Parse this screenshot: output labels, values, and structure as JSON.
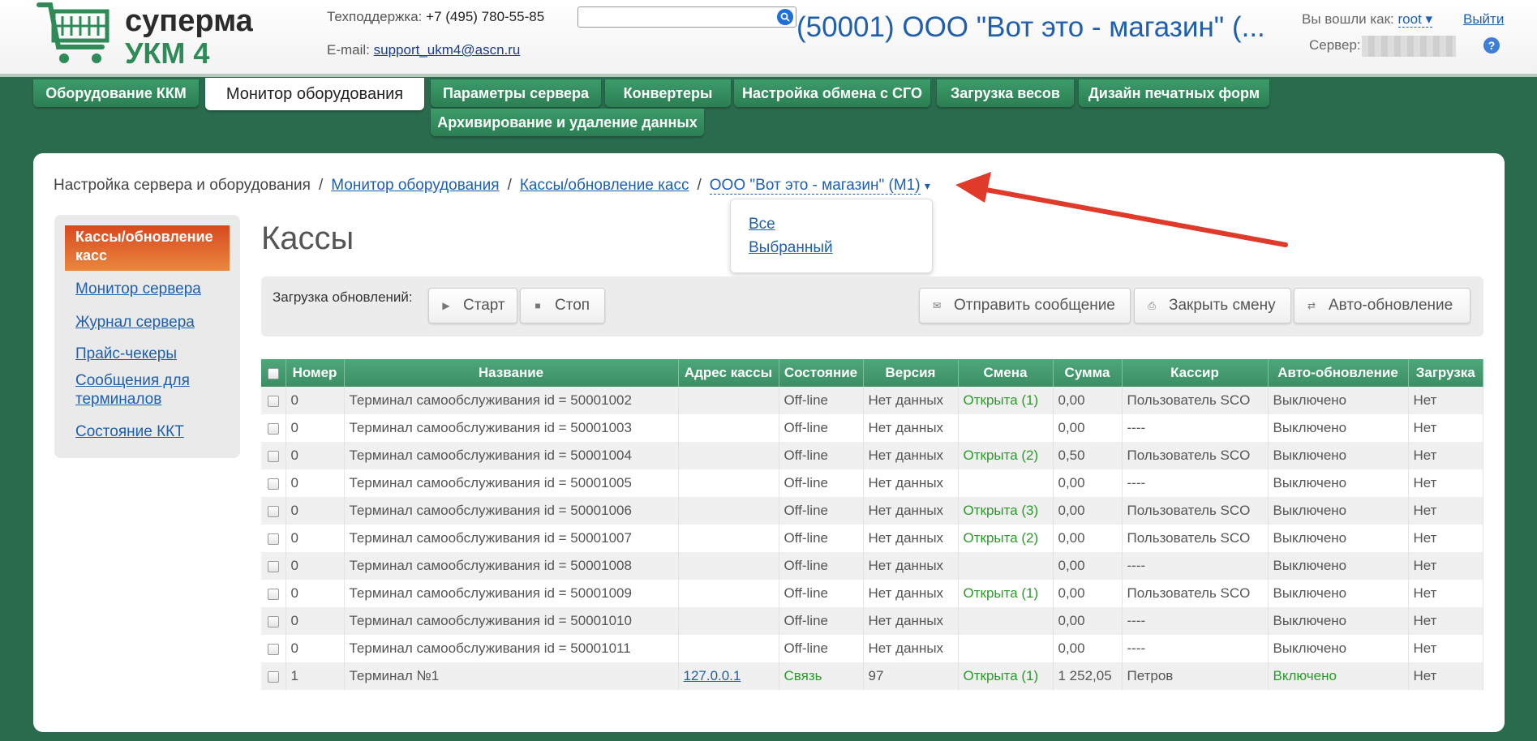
{
  "header": {
    "logo_line1": "супермаг",
    "logo_line2": "УКМ 4",
    "support_label": "Техподдержка:",
    "support_phone": "+7 (495) 780-55-85",
    "email_label": "E-mail:",
    "email": "support_ukm4@ascn.ru",
    "search_placeholder": "",
    "store_title": "(50001) ООО \"Вот это - магазин\" (...",
    "logged_in_label": "Вы вошли как:",
    "user": "root ▾",
    "logout": "Выйти",
    "server_label": "Сервер:",
    "help": "?"
  },
  "nav": {
    "tabs": [
      "Оборудование ККМ",
      "Монитор оборудования",
      "Параметры сервера",
      "Конвертеры",
      "Настройка обмена с СГО",
      "Загрузка весов",
      "Дизайн печатных форм",
      "Архивирование и удаление данных"
    ]
  },
  "breadcrumb": {
    "root": "Настройка сервера и оборудования",
    "sep": "/",
    "item1": "Монитор оборудования",
    "item2": "Кассы/обновление касс",
    "current": "ООО \"Вот это - магазин\" (М1)",
    "caret": "▾"
  },
  "dropdown": {
    "options": [
      "Все",
      "Выбранный"
    ]
  },
  "sidebar": {
    "active": "Кассы/обновление касс",
    "links": [
      "Монитор сервера",
      "Журнал сервера",
      "Прайс-чекеры",
      "Сообщения для терминалов",
      "Состояние ККТ"
    ]
  },
  "page_title": "Кассы",
  "toolbar": {
    "label": "Загрузка обновлений:",
    "start": "Старт",
    "stop": "Стоп",
    "send_message": "Отправить сообщение",
    "close_shift": "Закрыть смену",
    "auto_update": "Авто-обновление"
  },
  "table": {
    "columns": [
      "Номер",
      "Название",
      "Адрес кассы",
      "Состояние",
      "Версия",
      "Смена",
      "Сумма",
      "Кассир",
      "Авто-обновление",
      "Загрузка"
    ],
    "rows": [
      {
        "num": "0",
        "name": "Терминал самообслуживания id = 50001002",
        "addr": "",
        "state": "Off-line",
        "version": "Нет данных",
        "shift": "Открыта (1)",
        "sum": "0,00",
        "cashier": "Пользователь SCO",
        "auto": "Выключено",
        "load": "Нет"
      },
      {
        "num": "0",
        "name": "Терминал самообслуживания id = 50001003",
        "addr": "",
        "state": "Off-line",
        "version": "Нет данных",
        "shift": "",
        "sum": "0,00",
        "cashier": "----",
        "auto": "Выключено",
        "load": "Нет"
      },
      {
        "num": "0",
        "name": "Терминал самообслуживания id = 50001004",
        "addr": "",
        "state": "Off-line",
        "version": "Нет данных",
        "shift": "Открыта (2)",
        "sum": "0,50",
        "cashier": "Пользователь SCO",
        "auto": "Выключено",
        "load": "Нет"
      },
      {
        "num": "0",
        "name": "Терминал самообслуживания id = 50001005",
        "addr": "",
        "state": "Off-line",
        "version": "Нет данных",
        "shift": "",
        "sum": "0,00",
        "cashier": "----",
        "auto": "Выключено",
        "load": "Нет"
      },
      {
        "num": "0",
        "name": "Терминал самообслуживания id = 50001006",
        "addr": "",
        "state": "Off-line",
        "version": "Нет данных",
        "shift": "Открыта (3)",
        "sum": "0,00",
        "cashier": "Пользователь SCO",
        "auto": "Выключено",
        "load": "Нет"
      },
      {
        "num": "0",
        "name": "Терминал самообслуживания id = 50001007",
        "addr": "",
        "state": "Off-line",
        "version": "Нет данных",
        "shift": "Открыта (2)",
        "sum": "0,00",
        "cashier": "Пользователь SCO",
        "auto": "Выключено",
        "load": "Нет"
      },
      {
        "num": "0",
        "name": "Терминал самообслуживания id = 50001008",
        "addr": "",
        "state": "Off-line",
        "version": "Нет данных",
        "shift": "",
        "sum": "0,00",
        "cashier": "----",
        "auto": "Выключено",
        "load": "Нет"
      },
      {
        "num": "0",
        "name": "Терминал самообслуживания id = 50001009",
        "addr": "",
        "state": "Off-line",
        "version": "Нет данных",
        "shift": "Открыта (1)",
        "sum": "0,00",
        "cashier": "Пользователь SCO",
        "auto": "Выключено",
        "load": "Нет"
      },
      {
        "num": "0",
        "name": "Терминал самообслуживания id = 50001010",
        "addr": "",
        "state": "Off-line",
        "version": "Нет данных",
        "shift": "",
        "sum": "0,00",
        "cashier": "----",
        "auto": "Выключено",
        "load": "Нет"
      },
      {
        "num": "0",
        "name": "Терминал самообслуживания id = 50001011",
        "addr": "",
        "state": "Off-line",
        "version": "Нет данных",
        "shift": "",
        "sum": "0,00",
        "cashier": "----",
        "auto": "Выключено",
        "load": "Нет"
      },
      {
        "num": "1",
        "name": "Терминал №1",
        "addr": "127.0.0.1",
        "state": "Связь",
        "version": "97",
        "shift": "Открыта (1)",
        "sum": "1 252,05",
        "cashier": "Петров",
        "auto": "Включено",
        "load": "Нет"
      }
    ]
  },
  "colors": {
    "background": "#2a6a4d",
    "nav_green": "#3a8e63",
    "link_blue": "#1f5fae",
    "active_orange": "#d8491f",
    "status_green": "#2a9a2a",
    "arrow_red": "#e03a2b"
  }
}
